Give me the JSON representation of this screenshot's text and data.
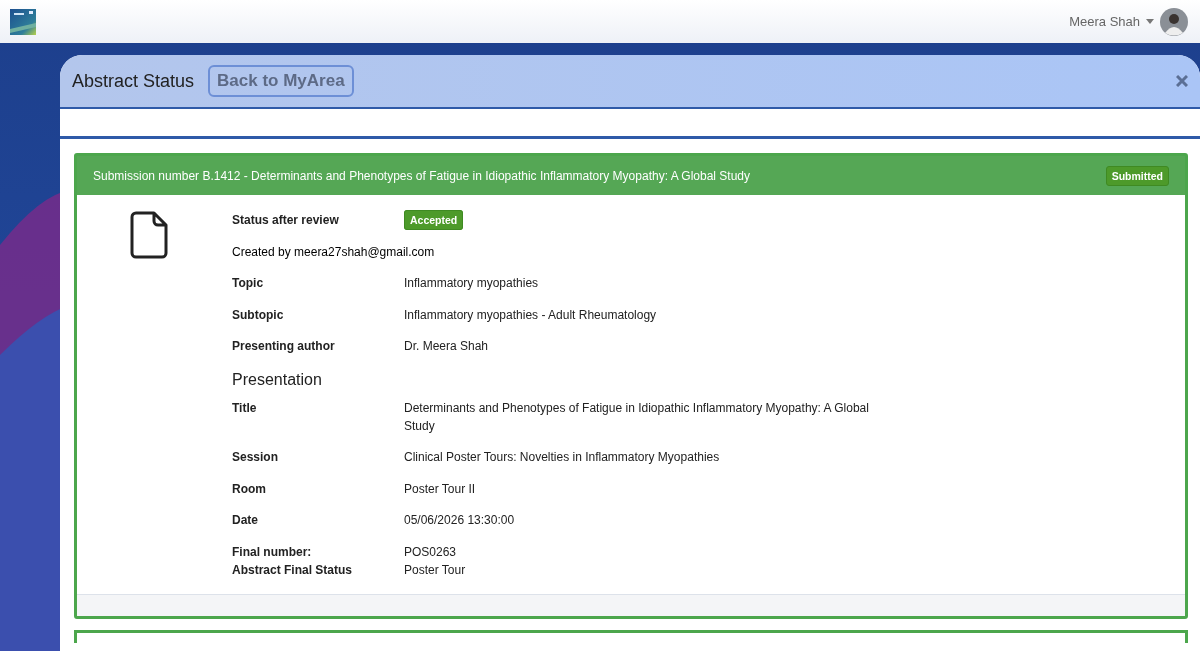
{
  "topbar": {
    "user_name": "Meera Shah"
  },
  "modal": {
    "title": "Abstract Status",
    "back_button": "Back to MyArea"
  },
  "submission": {
    "heading": "Submission number B.1412 - Determinants and Phenotypes of Fatigue in Idiopathic Inflammatory Myopathy: A Global Study",
    "status_badge": "Submitted",
    "fields": [
      {
        "kind": "badge",
        "label": "Status after review",
        "value": "Accepted"
      },
      {
        "kind": "note",
        "value": "Created by meera27shah@gmail.com"
      },
      {
        "kind": "field",
        "label": "Topic",
        "value": "Inflammatory myopathies"
      },
      {
        "kind": "field",
        "label": "Subtopic",
        "value": "Inflammatory myopathies - Adult Rheumatology"
      },
      {
        "kind": "field",
        "label": "Presenting author",
        "value": "Dr. Meera Shah"
      }
    ],
    "section_title": "Presentation",
    "presentation_fields": [
      {
        "kind": "field",
        "label": "Title",
        "value": "Determinants and Phenotypes of Fatigue in Idiopathic Inflammatory Myopathy: A Global Study"
      },
      {
        "kind": "field",
        "label": "Session",
        "value": "Clinical Poster Tours: Novelties in Inflammatory Myopathies"
      },
      {
        "kind": "field",
        "label": "Room",
        "value": "Poster Tour II"
      },
      {
        "kind": "field",
        "label": "Date",
        "value": "05/06/2026 13:30:00"
      },
      {
        "kind": "compact",
        "label": "Final number:",
        "value": "POS0263"
      },
      {
        "kind": "compact",
        "label": "Abstract Final Status",
        "value": "Poster Tour"
      }
    ]
  }
}
